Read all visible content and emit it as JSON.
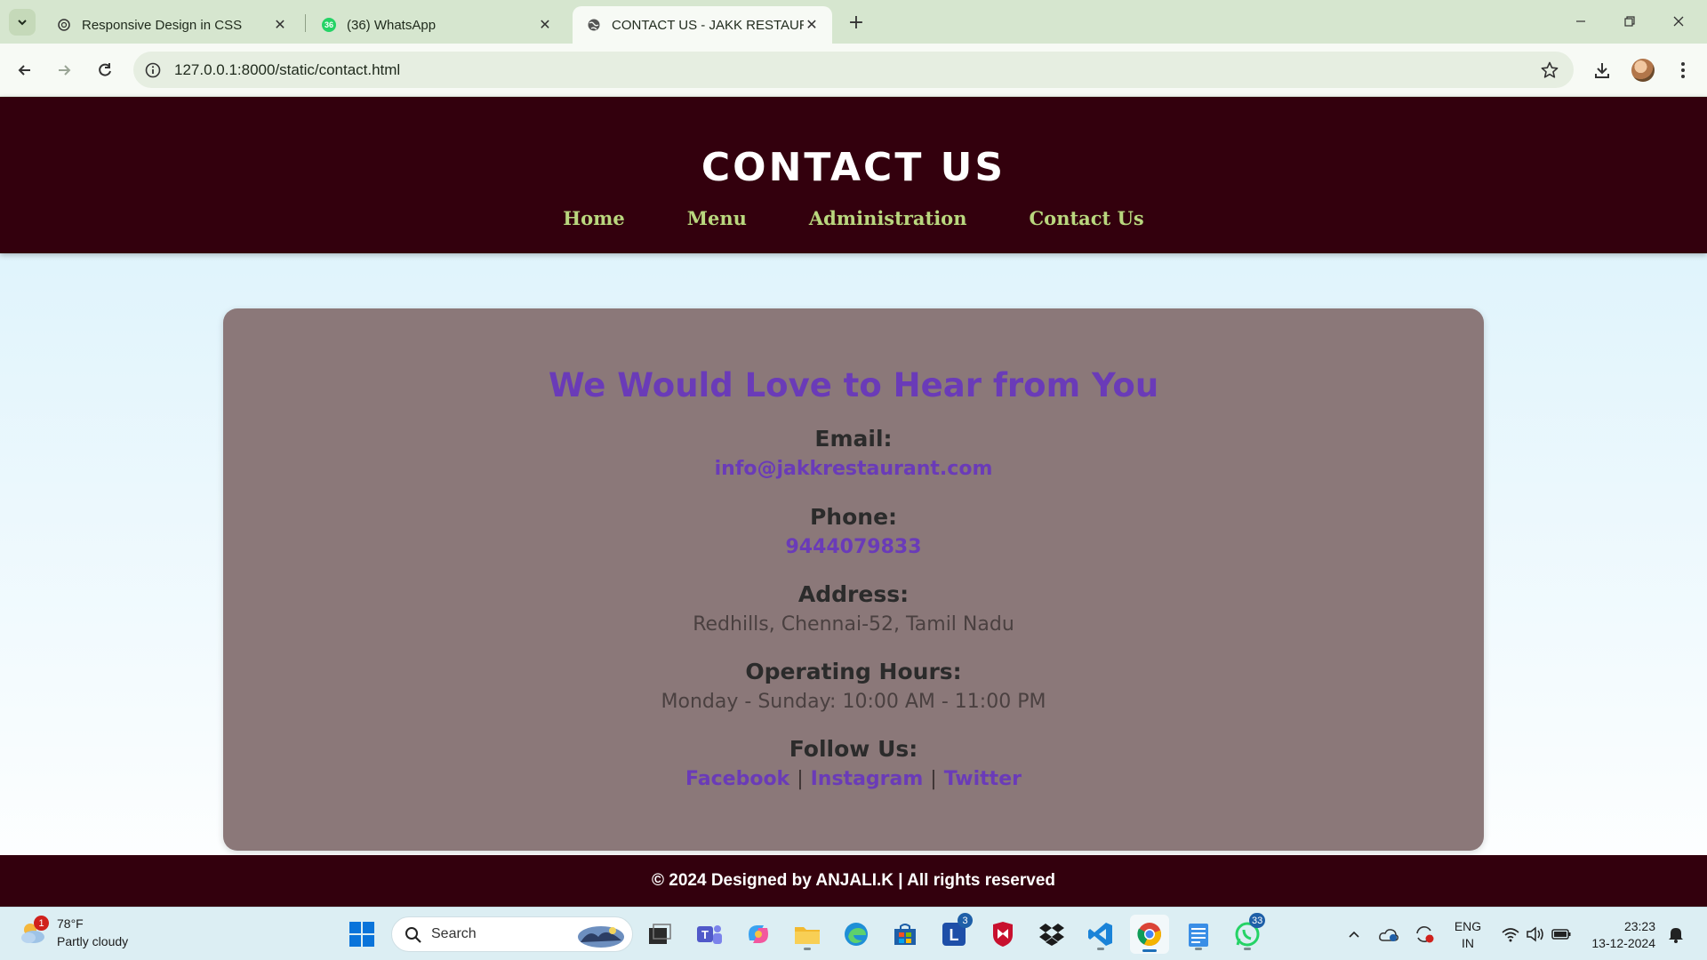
{
  "browser": {
    "tabs": [
      {
        "title": "Responsive Design in CSS",
        "icon": "chatgpt-icon",
        "active": false
      },
      {
        "title": "(36) WhatsApp",
        "icon": "whatsapp-icon",
        "badge": "36",
        "active": false
      },
      {
        "title": "CONTACT US - JAKK RESTAURA",
        "icon": "globe-icon",
        "active": true
      }
    ],
    "url": "127.0.0.1:8000/static/contact.html"
  },
  "site": {
    "title": "CONTACT US",
    "nav": [
      "Home",
      "Menu",
      "Administration",
      "Contact Us"
    ],
    "heading": "We Would Love to Hear from You",
    "email_label": "Email:",
    "email_value": "info@jakkrestaurant.com",
    "phone_label": "Phone:",
    "phone_value": "9444079833",
    "address_label": "Address:",
    "address_value": "Redhills, Chennai-52, Tamil Nadu",
    "hours_label": "Operating Hours:",
    "hours_value": "Monday - Sunday: 10:00 AM - 11:00 PM",
    "follow_label": "Follow Us:",
    "social": [
      "Facebook",
      "Instagram",
      "Twitter"
    ],
    "social_sep": "|",
    "footer": "© 2024 Designed by ANJALI.K | All rights reserved"
  },
  "taskbar": {
    "weather_temp": "78°F",
    "weather_desc": "Partly cloudy",
    "weather_badge": "1",
    "search_placeholder": "Search",
    "lens_badge": "3",
    "whatsapp_badge": "33",
    "lang_top": "ENG",
    "lang_bottom": "IN",
    "time": "23:23",
    "date": "13-12-2024"
  },
  "colors": {
    "header_bg": "#33000d",
    "nav_link": "#b9d77e",
    "card_bg": "#8b7879",
    "accent_purple": "#6a3bb8"
  }
}
